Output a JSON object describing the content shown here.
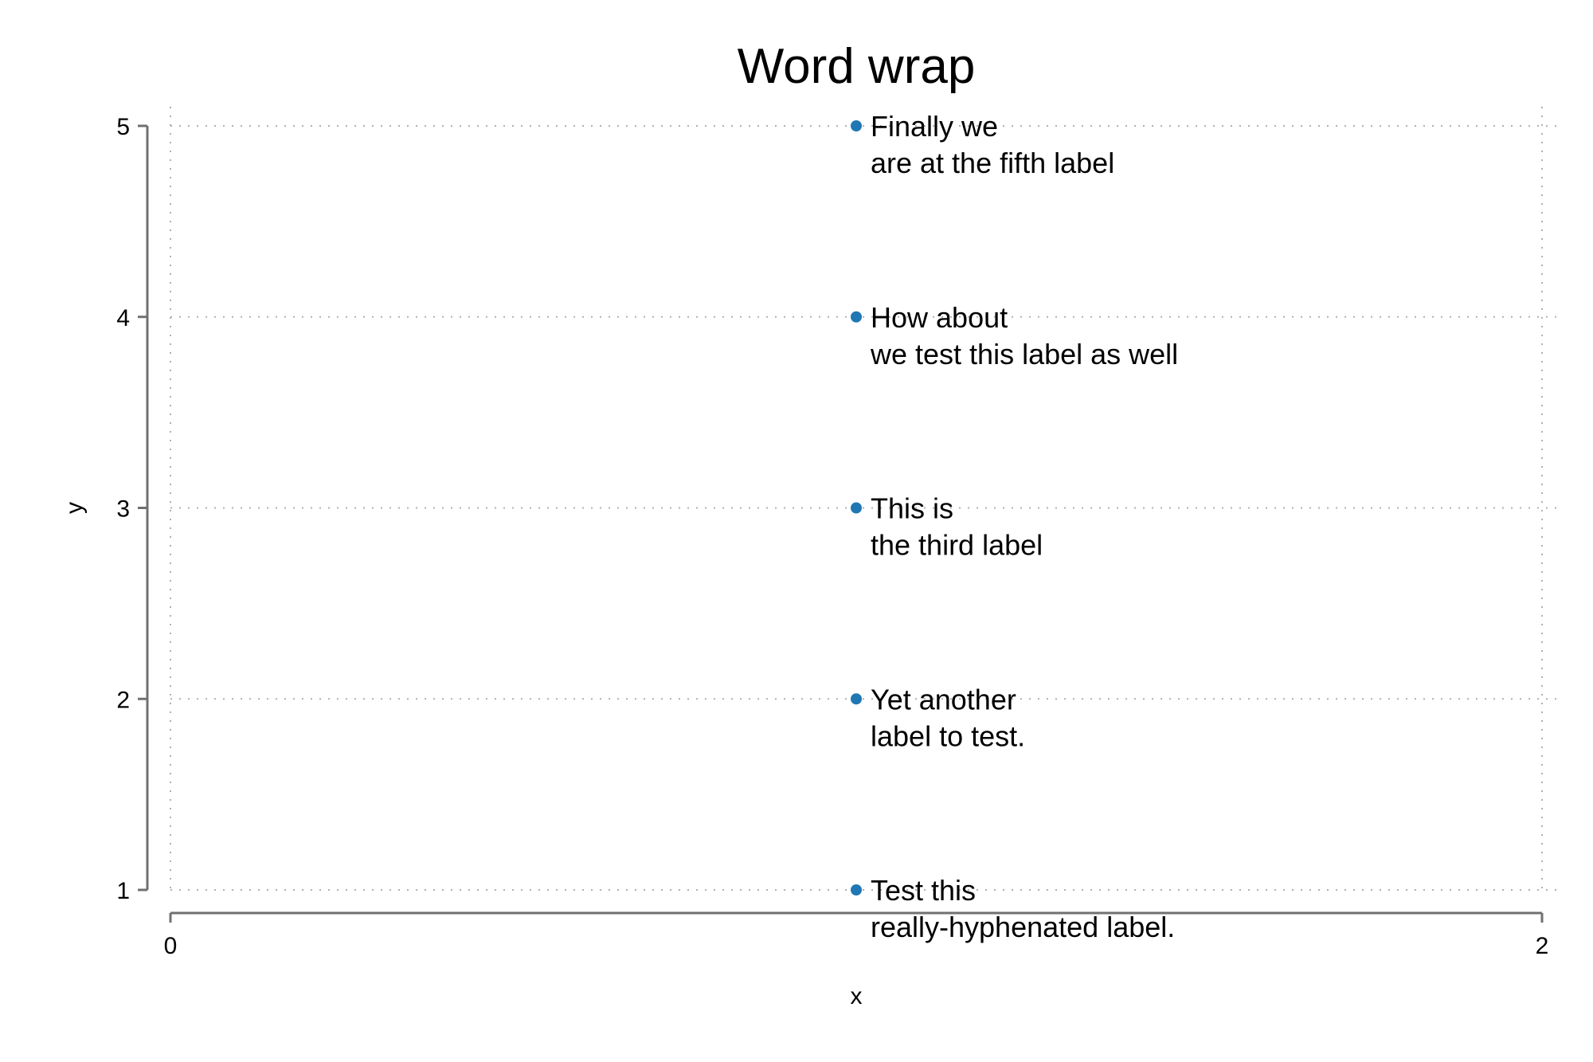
{
  "chart_data": {
    "type": "scatter",
    "title": "Word wrap",
    "xlabel": "x",
    "ylabel": "y",
    "xlim": [
      0,
      2
    ],
    "ylim": [
      1,
      5
    ],
    "x_ticks": [
      "0",
      "2"
    ],
    "y_ticks": [
      "1",
      "2",
      "3",
      "4",
      "5"
    ],
    "grid": true,
    "legend": "none",
    "series": [
      {
        "color": "#1f77b4",
        "points": [
          {
            "x": 1,
            "y": 1,
            "label": [
              "Test this",
              "really-hyphenated label."
            ]
          },
          {
            "x": 1,
            "y": 2,
            "label": [
              "Yet another",
              "label to test."
            ]
          },
          {
            "x": 1,
            "y": 3,
            "label": [
              "This is",
              "the third label"
            ]
          },
          {
            "x": 1,
            "y": 4,
            "label": [
              "How about",
              "we test this label as well"
            ]
          },
          {
            "x": 1,
            "y": 5,
            "label": [
              "Finally we",
              "are at the fifth label"
            ]
          }
        ]
      }
    ]
  }
}
